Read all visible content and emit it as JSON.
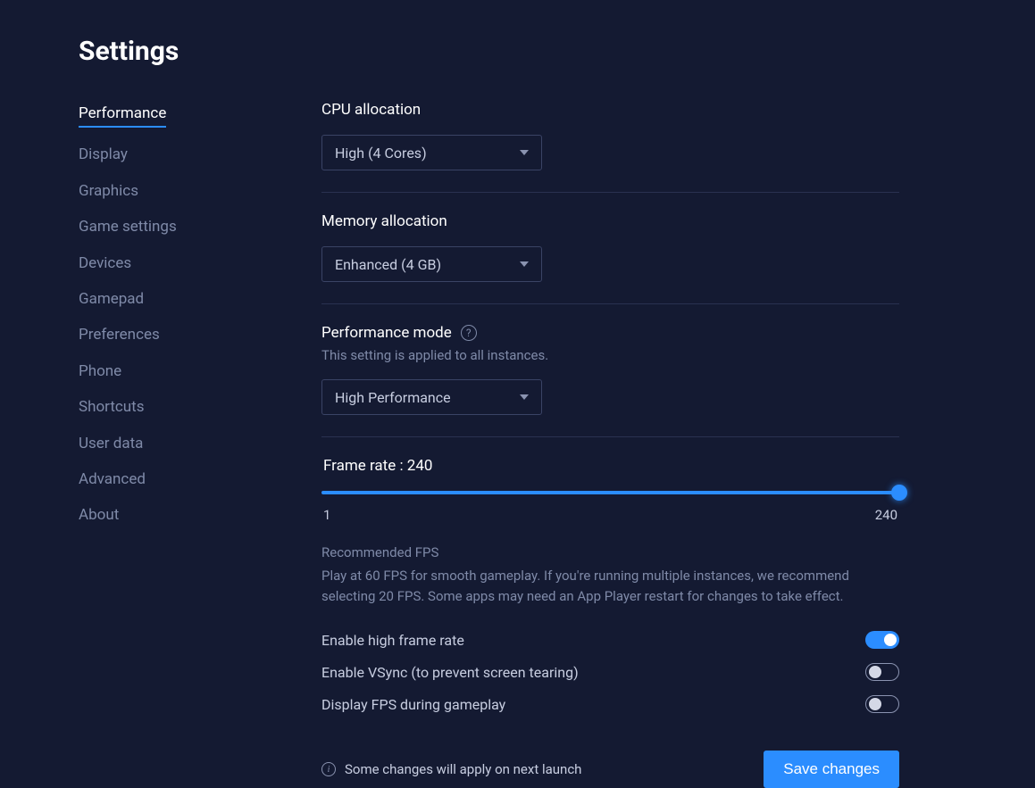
{
  "page": {
    "title": "Settings"
  },
  "sidebar": {
    "activeIndex": 0,
    "items": [
      {
        "label": "Performance"
      },
      {
        "label": "Display"
      },
      {
        "label": "Graphics"
      },
      {
        "label": "Game settings"
      },
      {
        "label": "Devices"
      },
      {
        "label": "Gamepad"
      },
      {
        "label": "Preferences"
      },
      {
        "label": "Phone"
      },
      {
        "label": "Shortcuts"
      },
      {
        "label": "User data"
      },
      {
        "label": "Advanced"
      },
      {
        "label": "About"
      }
    ]
  },
  "main": {
    "cpu": {
      "label": "CPU allocation",
      "value": "High (4 Cores)"
    },
    "memory": {
      "label": "Memory allocation",
      "value": "Enhanced (4 GB)"
    },
    "perfmode": {
      "label": "Performance mode",
      "note": "This setting is applied to all instances.",
      "value": "High Performance"
    },
    "framerate": {
      "label_prefix": "Frame rate : ",
      "value": 240,
      "min": 1,
      "max": 240,
      "rec_title": "Recommended FPS",
      "rec_text": "Play at 60 FPS for smooth gameplay. If you're running multiple instances, we recommend selecting 20 FPS. Some apps may need an App Player restart for changes to take effect."
    },
    "toggles": {
      "high_fps": {
        "label": "Enable high frame rate",
        "on": true
      },
      "vsync": {
        "label": "Enable VSync (to prevent screen tearing)",
        "on": false
      },
      "display_fps": {
        "label": "Display FPS during gameplay",
        "on": false
      }
    }
  },
  "footer": {
    "note": "Some changes will apply on next launch",
    "save": "Save changes"
  }
}
